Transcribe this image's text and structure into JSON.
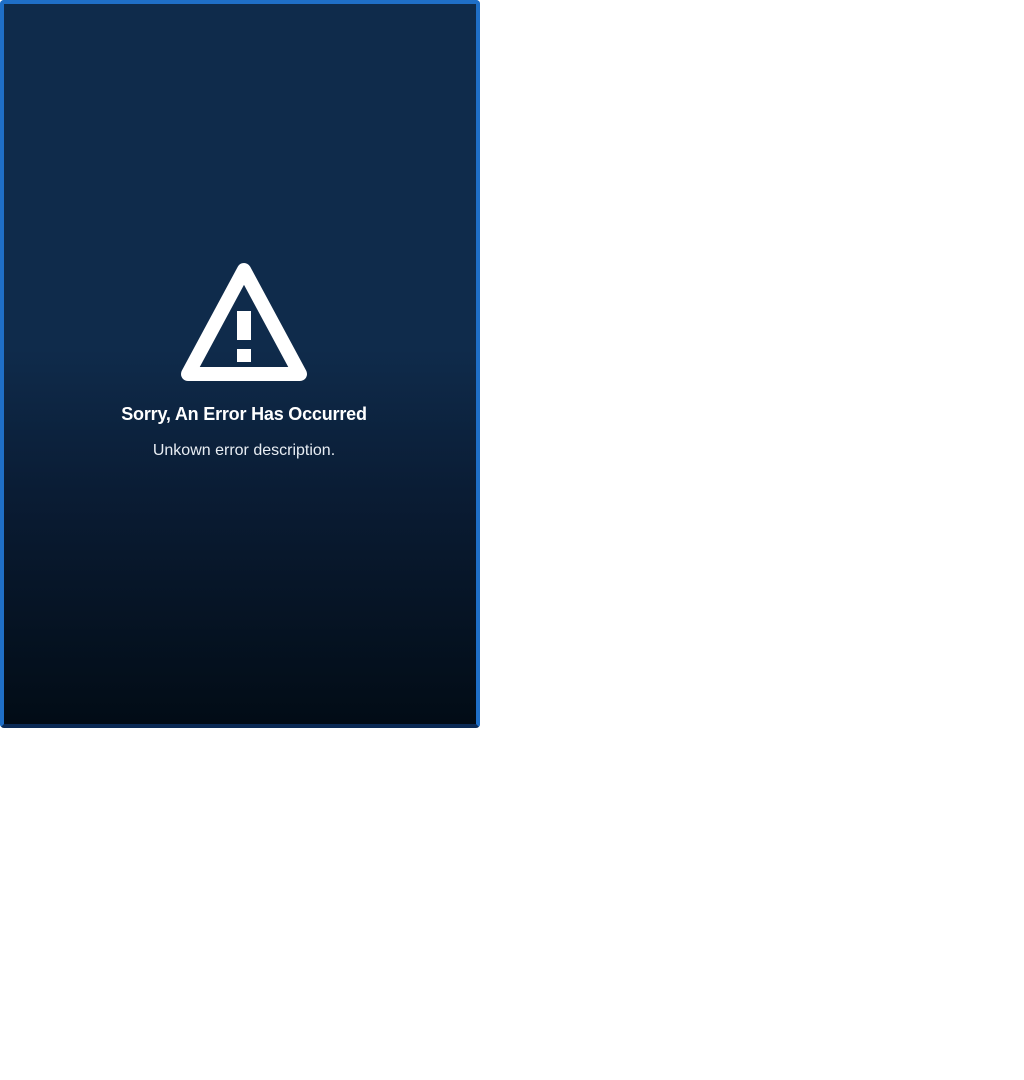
{
  "error": {
    "icon": "warning-triangle-icon",
    "title": "Sorry, An Error Has Occurred",
    "description": "Unkown error description."
  },
  "colors": {
    "page_background": "#ffffff",
    "panel_border": "#1f6fc7",
    "panel_gradient_top": "#0f2b4b",
    "panel_gradient_bottom": "#020c16",
    "text": "#ffffff"
  }
}
